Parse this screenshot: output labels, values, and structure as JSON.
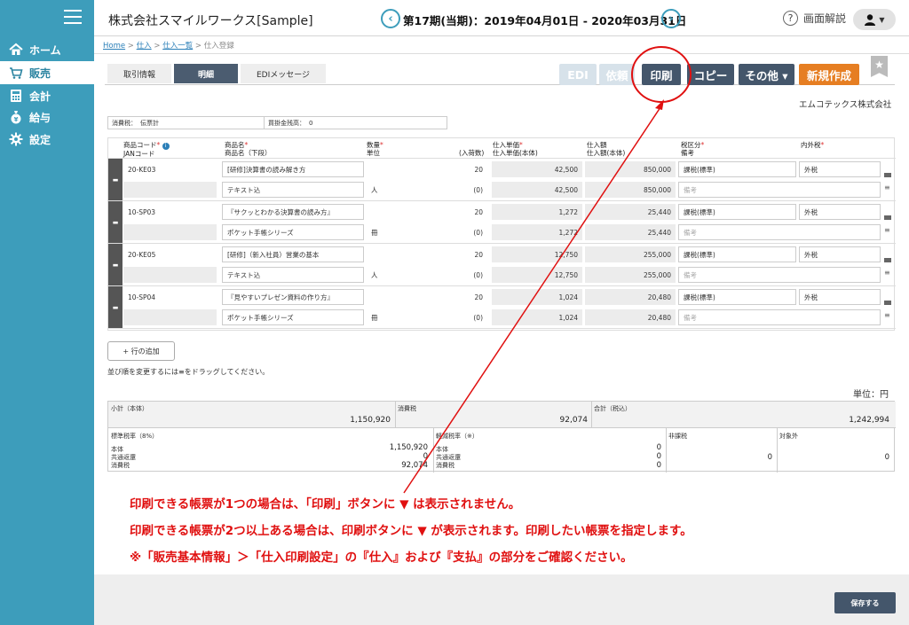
{
  "app": {
    "company": "株式会社スマイルワークス[Sample]",
    "period": "第17期(当期)：2019年04月01日 - 2020年03月31日",
    "prev": "‹",
    "next": "›",
    "help": "画面解説"
  },
  "nav": [
    {
      "label": "ホーム",
      "icon": "home-icon"
    },
    {
      "label": "販売",
      "icon": "cart-icon"
    },
    {
      "label": "会計",
      "icon": "calculator-icon"
    },
    {
      "label": "給与",
      "icon": "moneybag-icon"
    },
    {
      "label": "設定",
      "icon": "gear-icon"
    }
  ],
  "breadcrumb": {
    "home": "Home",
    "purchase": "仕入",
    "list": "仕入一覧",
    "current": "仕入登録",
    "sep": " > "
  },
  "tabs": [
    "取引情報",
    "明細",
    "EDIメッセージ"
  ],
  "toolbar": {
    "edi": "EDI",
    "request": "依頼",
    "print": "印刷",
    "copy": "コピー",
    "other": "その他 ▾",
    "new": "新規作成"
  },
  "customer": "エムコテックス株式会社",
  "taxinfo": {
    "tax": "消費税：",
    "tax_value": "伝票計",
    "balance": "買掛金残高：",
    "balance_value": "0"
  },
  "headers": {
    "code": "商品コード",
    "jan": "JANコード",
    "name": "商品名",
    "name2": "商品名（下段）",
    "qty": "数量",
    "unit": "単位",
    "pack": "(入荷数)",
    "price": "仕入単価",
    "price2": "仕入単価(本体)",
    "amount": "仕入額",
    "amount2": "仕入額(本体)",
    "taxcat": "税区分",
    "memo": "備考",
    "intax": "内外税",
    "req": "*",
    "info": "i"
  },
  "rows": [
    {
      "code": "20-KE03",
      "name": "[研修]決算書の読み解き方",
      "name2": "テキスト込",
      "qty": "20",
      "unit": "人",
      "pack": "(0)",
      "price": "42,500",
      "price2": "42,500",
      "amount": "850,000",
      "amount2": "850,000",
      "taxcat": "課税(標準)",
      "intax": "外税",
      "memo": "備考"
    },
    {
      "code": "10-SP03",
      "name": "『サクッとわかる決算書の読み方』",
      "name2": "ポケット手帳シリーズ",
      "qty": "20",
      "unit": "冊",
      "pack": "(0)",
      "price": "1,272",
      "price2": "1,272",
      "amount": "25,440",
      "amount2": "25,440",
      "taxcat": "課税(標準)",
      "intax": "外税",
      "memo": "備考"
    },
    {
      "code": "20-KE05",
      "name": "[研修]（新入社員）営業の基本",
      "name2": "テキスト込",
      "qty": "20",
      "unit": "人",
      "pack": "(0)",
      "price": "12,750",
      "price2": "12,750",
      "amount": "255,000",
      "amount2": "255,000",
      "taxcat": "課税(標準)",
      "intax": "外税",
      "memo": "備考"
    },
    {
      "code": "10-SP04",
      "name": "『見やすいプレゼン資料の作り方』",
      "name2": "ポケット手帳シリーズ",
      "qty": "20",
      "unit": "冊",
      "pack": "(0)",
      "price": "1,024",
      "price2": "1,024",
      "amount": "20,480",
      "amount2": "20,480",
      "taxcat": "課税(標準)",
      "intax": "外税",
      "memo": "備考"
    }
  ],
  "addrow": "+ 行の追加",
  "draghint": "並び順を変更するには≡をドラッグしてください。",
  "unit": "単位：円",
  "totals": {
    "subtotal_label": "小計（本体）",
    "subtotal": "1,150,920",
    "tax_label": "消費税",
    "tax": "92,074",
    "total_label": "合計（税込）",
    "total": "1,242,994",
    "std_label": "標準税率（8%）",
    "red_label": "軽減税率（※）",
    "nontax_label": "非課税",
    "exempt_label": "対象外",
    "body": "本体",
    "common": "共通返還",
    "ctax": "消費税",
    "std_body": "1,150,920",
    "std_common": "0",
    "std_tax": "92,074",
    "red_body": "0",
    "red_common": "0",
    "red_tax": "0",
    "nontax": "0",
    "exempt": "0"
  },
  "notes": [
    "印刷できる帳票が1つの場合は、「印刷」ボタンに ▼ は表示されません。",
    "印刷できる帳票が2つ以上ある場合は、印刷ボタンに ▼ が表示されます。印刷したい帳票を指定します。",
    "※「販売基本情報」＞「仕入印刷設定」の『仕入』および『支払』の部分をご確認ください。"
  ],
  "save": "保存する",
  "colors": {
    "sidebar": "#3d9dbb",
    "print": "#44566b",
    "new": "#e67e22",
    "annotation": "#e01010"
  }
}
